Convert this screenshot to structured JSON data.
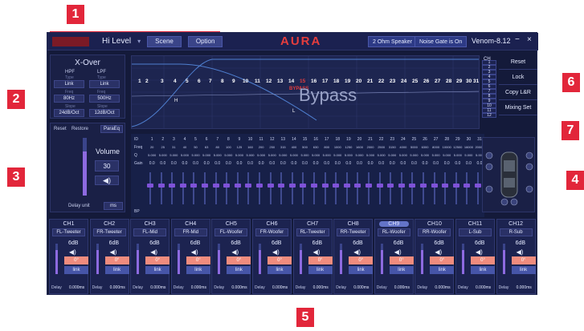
{
  "topbar": {
    "level": "Hi Level",
    "scene": "Scene",
    "option": "Option",
    "brand": "AURA",
    "speaker": "2 Ohm Speaker",
    "noise_gate": "Noise Gate is On",
    "device": "Venom-8.12",
    "minimize": "−",
    "close": "×"
  },
  "xover": {
    "title": "X-Over",
    "hpf": "HPF",
    "lpf": "LPF",
    "type_label": "Type",
    "freq_label": "Freq",
    "slope_label": "Slope",
    "hpf_type": "Link",
    "lpf_type": "Link",
    "hpf_freq": "80Hz",
    "lpf_freq": "500Hz",
    "hpf_slope": "24dB/Oct",
    "lpf_slope": "12dB/Oct"
  },
  "eq": {
    "bypass": "Bypass",
    "bypass_label": "BYPASS",
    "marker_h": "H",
    "marker_l": "L",
    "band_ids": [
      "1",
      "2",
      "3",
      "4",
      "5",
      "6",
      "7",
      "8",
      "9",
      "10",
      "11",
      "12",
      "13",
      "14",
      "15",
      "16",
      "17",
      "18",
      "19",
      "20",
      "21",
      "22",
      "23",
      "24",
      "25",
      "26",
      "27",
      "28",
      "29",
      "30",
      "31"
    ]
  },
  "volume": {
    "reset": "Reset",
    "restore": "Restore",
    "mode": "ParaEq",
    "label": "Volume",
    "value": "30",
    "delay_unit_label": "Delay unit",
    "delay_unit": "ms",
    "level_fraction": 0.77
  },
  "eqtable": {
    "id_label": "ID",
    "freq_label": "Freq",
    "q_label": "Q",
    "gain_label": "Gain",
    "bp_label": "BP",
    "freqs": [
      "20",
      "25",
      "31",
      "40",
      "50",
      "63",
      "80",
      "100",
      "125",
      "160",
      "200",
      "250",
      "315",
      "400",
      "500",
      "630",
      "800",
      "1000",
      "1250",
      "1600",
      "2000",
      "2500",
      "3150",
      "4000",
      "5000",
      "6300",
      "8000",
      "10000",
      "12500",
      "16000",
      "20000"
    ],
    "q": "5.000",
    "gain": "0.0"
  },
  "right": {
    "ch_label": "CH",
    "ch_numbers": [
      "1",
      "2",
      "3",
      "4",
      "5",
      "6",
      "7",
      "8",
      "9",
      "10",
      "11",
      "12"
    ],
    "reset": "Reset",
    "lock": "Lock",
    "copy": "Copy L&R",
    "mixing": "Mixing Set"
  },
  "channels": [
    {
      "name": "CH1",
      "speaker": "FL-Tweeter",
      "db": "6dB",
      "deg": "0°",
      "link": "link",
      "delay_label": "Delay",
      "delay": "0.000ms"
    },
    {
      "name": "CH2",
      "speaker": "FR-Tweeter",
      "db": "6dB",
      "deg": "0°",
      "link": "link",
      "delay_label": "Delay",
      "delay": "0.000ms"
    },
    {
      "name": "CH3",
      "speaker": "FL-Mid",
      "db": "6dB",
      "deg": "0°",
      "link": "link",
      "delay_label": "Delay",
      "delay": "0.000ms"
    },
    {
      "name": "CH4",
      "speaker": "FR-Mid",
      "db": "6dB",
      "deg": "0°",
      "link": "link",
      "delay_label": "Delay",
      "delay": "0.000ms"
    },
    {
      "name": "CH5",
      "speaker": "FL-Woofer",
      "db": "6dB",
      "deg": "0°",
      "link": "link",
      "delay_label": "Delay",
      "delay": "0.000ms"
    },
    {
      "name": "CH6",
      "speaker": "FR-Woofer",
      "db": "6dB",
      "deg": "0°",
      "link": "link",
      "delay_label": "Delay",
      "delay": "0.000ms"
    },
    {
      "name": "CH7",
      "speaker": "RL-Tweeter",
      "db": "6dB",
      "deg": "0°",
      "link": "link",
      "delay_label": "Delay",
      "delay": "0.000ms"
    },
    {
      "name": "CH8",
      "speaker": "RR-Tweeter",
      "db": "6dB",
      "deg": "0°",
      "link": "link",
      "delay_label": "Delay",
      "delay": "0.000ms"
    },
    {
      "name": "CH9",
      "speaker": "RL-Woofer",
      "db": "6dB",
      "deg": "0°",
      "link": "link",
      "delay_label": "Delay",
      "delay": "0.000ms"
    },
    {
      "name": "CH10",
      "speaker": "RR-Woofer",
      "db": "6dB",
      "deg": "0°",
      "link": "link",
      "delay_label": "Delay",
      "delay": "0.000ms"
    },
    {
      "name": "CH11",
      "speaker": "L-Sub",
      "db": "6dB",
      "deg": "0°",
      "link": "link",
      "delay_label": "Delay",
      "delay": "0.000ms"
    },
    {
      "name": "CH12",
      "speaker": "R-Sub",
      "db": "6dB",
      "deg": "0°",
      "link": "link",
      "delay_label": "Delay",
      "delay": "0.000ms"
    }
  ],
  "markers": [
    "1",
    "2",
    "3",
    "4",
    "5",
    "6",
    "7"
  ],
  "colors": {
    "accent": "#e2263a",
    "panel": "#141a3a",
    "slider": "#8d6ae0",
    "phase": "#f08c7e"
  }
}
